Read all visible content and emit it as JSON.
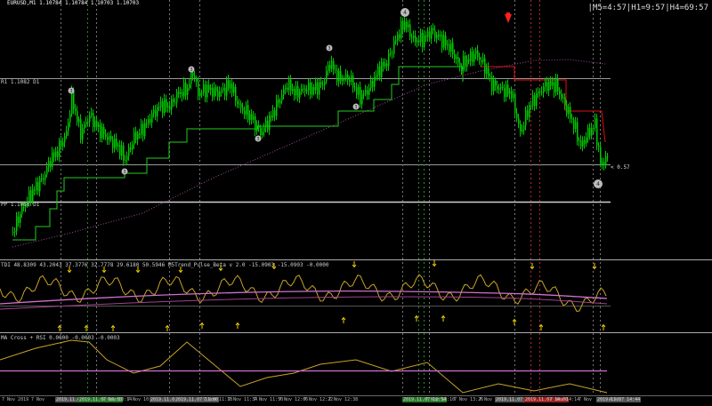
{
  "window": {
    "symbol_line": "EURUSD,M1  1.10784 1.10784 1.10703 1.10703",
    "clock_readout": "|M5=4:57|H1=9:57|H4=69:57",
    "colors": {
      "bull": "#00c800",
      "bear": "#00c800",
      "background": "#000000",
      "accent": "#ff2020"
    }
  },
  "levels": {
    "r1_label": "R1 1.1082 D1",
    "pp_label": "PP 1.1066 D1",
    "price_tag": "< 0.57"
  },
  "wave_markers": [
    "4",
    "3",
    "3",
    "3",
    "3",
    "3",
    "3",
    "3",
    "4"
  ],
  "subwindow1": {
    "label": "TDI 48.8309 43.2043 37.3776 32.7778 29.6180 50.5946  M5Trend_Pulse_Beta v 2.0 -15.0903 -15.0903 -0.0000"
  },
  "subwindow2": {
    "label": "MA Cross + RSI 0.0000 -0.0003 -0.0003"
  },
  "time_axis": {
    "ticks": [
      {
        "text": "7 Nov 2019",
        "hl": false
      },
      {
        "text": "7 Nov",
        "hl": false
      },
      {
        "text": "2019.11.07 09:44",
        "hl": true,
        "color": "#555"
      },
      {
        "text": "2019.11.07 10:00",
        "hl": true,
        "color": "#2a7a2a"
      },
      {
        "text": "7 Nov 10:14",
        "hl": false
      },
      {
        "text": "7 Nov 10:30",
        "hl": false
      },
      {
        "text": "2019.11.07 10:44",
        "hl": true,
        "color": "#555"
      },
      {
        "text": "2019.11.07 11:00",
        "hl": true,
        "color": "#555"
      },
      {
        "text": "7 Nov 11:18",
        "hl": false
      },
      {
        "text": "7 Nov 11:34",
        "hl": false
      },
      {
        "text": "7 Nov 11:50",
        "hl": false
      },
      {
        "text": "7 Nov 12:06",
        "hl": false
      },
      {
        "text": "7 Nov 12:22",
        "hl": false
      },
      {
        "text": "7 Nov 12:38",
        "hl": false
      },
      {
        "text": "2019.11.07 12:54",
        "hl": true,
        "color": "#2a7a2a"
      },
      {
        "text": "7 Nov 13:10",
        "hl": false
      },
      {
        "text": "7 Nov 13:26",
        "hl": false
      },
      {
        "text": "7 Nov",
        "hl": false
      },
      {
        "text": "2019.11.07 13:44",
        "hl": true,
        "color": "#555"
      },
      {
        "text": "2019.11.07 14:00",
        "hl": true,
        "color": "#a02020"
      },
      {
        "text": "7 Nov 14:14",
        "hl": false
      },
      {
        "text": "7 Nov",
        "hl": false
      },
      {
        "text": "2019.11.07 14:44",
        "hl": true,
        "color": "#555"
      },
      {
        "text": "4:46",
        "hl": false
      }
    ]
  }
}
